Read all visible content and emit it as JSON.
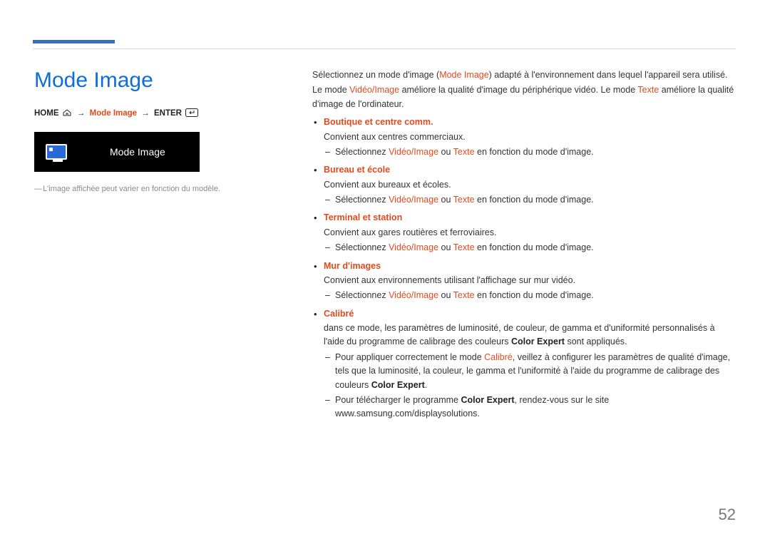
{
  "page": {
    "title": "Mode Image",
    "number": "52"
  },
  "path": {
    "home": "HOME",
    "modeimage": "Mode Image",
    "enter": "ENTER"
  },
  "preview": {
    "label": "Mode Image"
  },
  "left": {
    "footnote": "L'image affichée peut varier en fonction du modèle."
  },
  "intro": {
    "p1_a": "Sélectionnez un mode d'image (",
    "p1_b": "Mode Image",
    "p1_c": ") adapté à l'environnement dans lequel l'appareil sera utilisé.",
    "p2_a": "Le mode ",
    "p2_b": "Vidéo/Image",
    "p2_c": " améliore la qualité d'image du périphérique vidéo. Le mode ",
    "p2_d": "Texte",
    "p2_e": " améliore la qualité d'image de l'ordinateur."
  },
  "sel": {
    "a": "Sélectionnez ",
    "vi": "Vidéo/Image",
    "b": " ou ",
    "tx": "Texte",
    "c": " en fonction du mode d'image."
  },
  "modes": {
    "m1": {
      "title": "Boutique et centre comm.",
      "desc": "Convient aux centres commerciaux."
    },
    "m2": {
      "title": "Bureau et école",
      "desc": "Convient aux bureaux et écoles."
    },
    "m3": {
      "title": "Terminal et station",
      "desc": "Convient aux gares routières et ferroviaires."
    },
    "m4": {
      "title": "Mur d'images",
      "desc": "Convient aux environnements utilisant l'affichage sur mur vidéo."
    },
    "m5": {
      "title": "Calibré",
      "desc_a": "dans ce mode, les paramètres de luminosité, de couleur, de gamma et d'uniformité personnalisés à l'aide du programme de calibrage des couleurs ",
      "desc_b": "Color Expert",
      "desc_c": " sont appliqués.",
      "s1_a": "Pour appliquer correctement le mode ",
      "s1_b": "Calibré",
      "s1_c": ", veillez à configurer les paramètres de qualité d'image, tels que la luminosité, la couleur, le gamma et l'uniformité à l'aide du programme de calibrage des couleurs ",
      "s1_d": "Color Expert",
      "s1_e": ".",
      "s2_a": "Pour télécharger le programme ",
      "s2_b": "Color Expert",
      "s2_c": ", rendez-vous sur le site www.samsung.com/displaysolutions."
    }
  }
}
